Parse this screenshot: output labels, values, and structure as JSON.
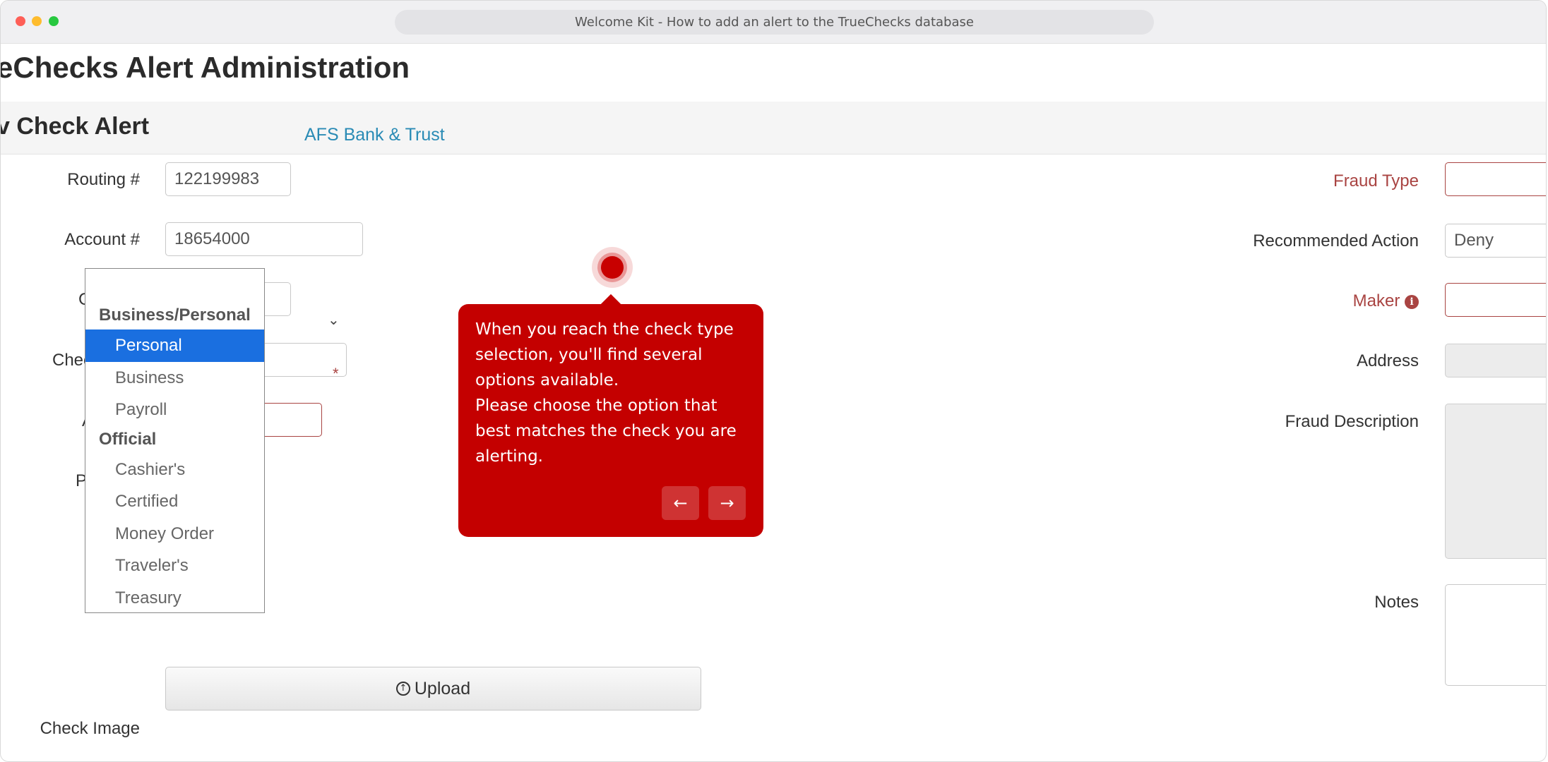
{
  "window": {
    "title": "Welcome Kit - How to add an alert to the TrueChecks database"
  },
  "app": {
    "title": "eChecks Alert Administration",
    "section_title": "v Check Alert"
  },
  "form_left": {
    "routing_label": "Routing #",
    "routing_value": "122199983",
    "bank_name": "AFS Bank & Trust",
    "account_label": "Account #",
    "account_value": "18654000",
    "check_number_label_fragment": "C",
    "check_type_label_fragment": "Chec",
    "amount_label_fragment": "A",
    "payee_label_fragment": "P",
    "required_mark": "*",
    "check_image_label": "Check Image",
    "upload_label": "Upload"
  },
  "dropdown": {
    "groups": [
      {
        "label": "Business/Personal",
        "options": [
          "Personal",
          "Business",
          "Payroll"
        ]
      },
      {
        "label": "Official",
        "options": [
          "Cashier's",
          "Certified",
          "Money Order",
          "Traveler's",
          "Treasury"
        ]
      }
    ],
    "selected": "Personal"
  },
  "form_right": {
    "fraud_type_label": "Fraud Type",
    "recommended_action_label": "Recommended Action",
    "recommended_action_value": "Deny",
    "maker_label": "Maker",
    "address_label": "Address",
    "fraud_description_label": "Fraud Description",
    "notes_label": "Notes"
  },
  "tooltip": {
    "line1": "When you reach the check type selection, you'll find several options available.",
    "line2": "Please choose the option that best matches the check you are alerting.",
    "prev_icon": "←",
    "next_icon": "→"
  },
  "colors": {
    "accent_red": "#c40000",
    "link_blue": "#2a8bb5",
    "danger_label": "#a94442",
    "selected_option": "#1a6fe0"
  }
}
